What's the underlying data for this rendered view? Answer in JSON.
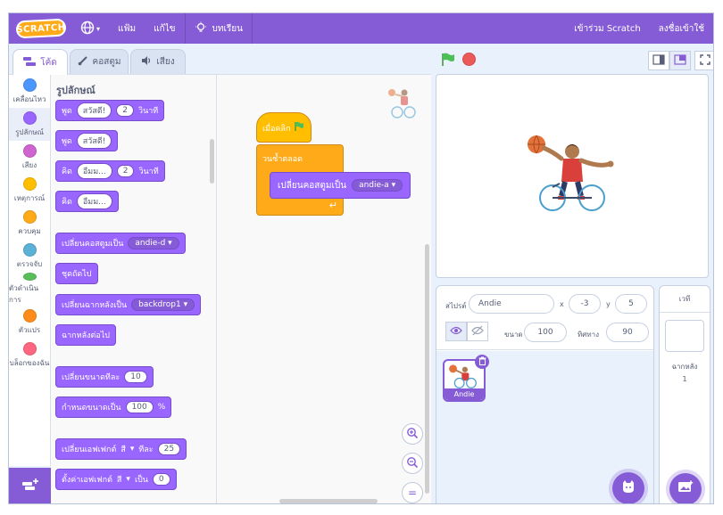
{
  "menubar": {
    "logo": "SCRATCH",
    "file": "แฟ้ม",
    "edit": "แก้ไข",
    "tutorials": "บทเรียน",
    "join": "เข้าร่วม Scratch",
    "signin": "ลงชื่อเข้าใช้"
  },
  "tabs": {
    "code": "โค้ด",
    "costumes": "คอสตูม",
    "sounds": "เสียง"
  },
  "categories": [
    {
      "label": "เคลื่อนไหว",
      "color": "#4c97ff"
    },
    {
      "label": "รูปลักษณ์",
      "color": "#9966ff"
    },
    {
      "label": "เสียง",
      "color": "#cf63cf"
    },
    {
      "label": "เหตุการณ์",
      "color": "#ffbf00"
    },
    {
      "label": "ควบคุม",
      "color": "#ffab19"
    },
    {
      "label": "ตรวจจับ",
      "color": "#5cb1d6"
    },
    {
      "label": "ตัวดำเนินการ",
      "color": "#59c059"
    },
    {
      "label": "ตัวแปร",
      "color": "#ff8c1a"
    },
    {
      "label": "บล็อกของฉัน",
      "color": "#ff6680"
    }
  ],
  "palette": {
    "heading": "รูปลักษณ์",
    "b1": {
      "say": "พูด",
      "msg": "สวัสดี!",
      "secs": "2",
      "unit": "วินาที"
    },
    "b2": {
      "say": "พูด",
      "msg": "สวัสดี!"
    },
    "b3": {
      "think": "คิด",
      "msg": "อืมม...",
      "secs": "2",
      "unit": "วินาที"
    },
    "b4": {
      "think": "คิด",
      "msg": "อืมม..."
    },
    "b5": {
      "label": "เปลี่ยนคอสตูมเป็น",
      "value": "andie-d"
    },
    "b6": {
      "label": "ชุดถัดไป"
    },
    "b7": {
      "label": "เปลี่ยนฉากหลังเป็น",
      "value": "backdrop1"
    },
    "b8": {
      "label": "ฉากหลังต่อไป"
    },
    "b9": {
      "label": "เปลี่ยนขนาดทีละ",
      "value": "10"
    },
    "b10": {
      "label": "กำหนดขนาดเป็น",
      "value": "100",
      "unit": "%"
    },
    "b11": {
      "label": "เปลี่ยนเอฟเฟกต์",
      "effect": "สี",
      "by": "ทีละ",
      "value": "25"
    },
    "b12": {
      "label": "ตั้งค่าเอฟเฟกต์",
      "effect": "สี",
      "to": "เป็น",
      "value": "0"
    }
  },
  "script": {
    "hat": "เมื่อคลิก",
    "forever": "วนซ้ำตลอด",
    "switch_label": "เปลี่ยนคอสตูมเป็น",
    "switch_value": "andie-a"
  },
  "sprite_info": {
    "sprite_label": "สไปรต์",
    "name": "Andie",
    "x_label": "x",
    "x": "-3",
    "y_label": "y",
    "y": "5",
    "size_label": "ขนาด",
    "size": "100",
    "direction_label": "ทิศทาง",
    "direction": "90"
  },
  "sprite_list": [
    {
      "name": "Andie"
    }
  ],
  "stage_pane": {
    "title": "เวที",
    "backdrop_label": "ฉากหลัง",
    "backdrop_count": "1"
  },
  "colors": {
    "accent": "#855cd6",
    "looks": "#9966ff",
    "events": "#ffbf00",
    "control": "#ffab19",
    "flag": "#4cbf56",
    "stop": "#ec5959"
  }
}
